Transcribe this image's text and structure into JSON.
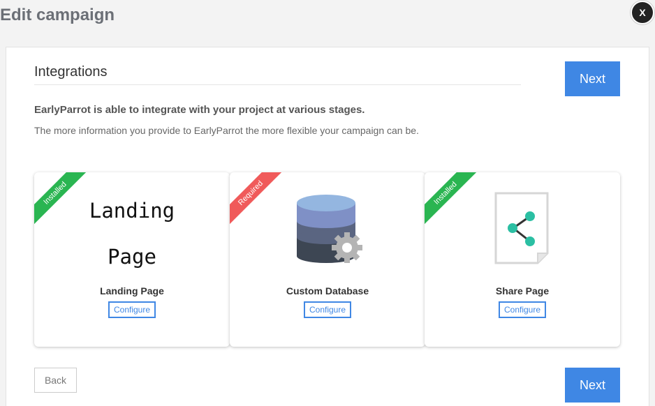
{
  "header": {
    "title": "Edit campaign",
    "close_label": "X"
  },
  "section": {
    "title": "Integrations",
    "intro_bold": "EarlyParrot is able to integrate with your project at various stages.",
    "intro_text": "The more information you provide to EarlyParrot the more flexible your campaign can be."
  },
  "buttons": {
    "next": "Next",
    "back": "Back"
  },
  "cards": [
    {
      "name": "Landing Page",
      "status": "Installed",
      "configure": "Configure",
      "art_line1": "Landing",
      "art_line2": "Page"
    },
    {
      "name": "Custom Database",
      "status": "Required",
      "configure": "Configure"
    },
    {
      "name": "Share Page",
      "status": "Installed",
      "configure": "Configure"
    }
  ],
  "colors": {
    "accent": "#3f87e4",
    "installed": "#2ab551",
    "required": "#f05a5a"
  }
}
